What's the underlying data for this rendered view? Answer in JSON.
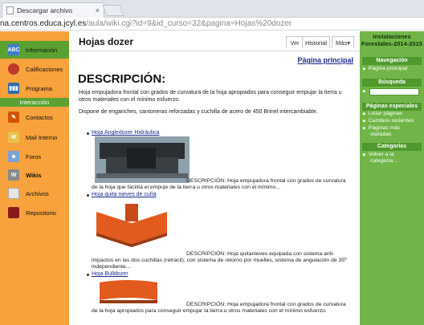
{
  "browser": {
    "tab_title": "Descargar archivo",
    "tab_close": "×",
    "url_host": "na.centros.educa.jcyl.es",
    "url_path": "/aula/wiki.cgi?id=9&id_curso=32&pagina=Hojas%20dozer"
  },
  "sidebar": {
    "items": [
      {
        "label": "Información",
        "icon": "info-icon",
        "color": "#3a7fd0"
      },
      {
        "label": "Calificaciones",
        "icon": "ribbon-icon",
        "color": "#c0392b"
      },
      {
        "label": "Programa",
        "icon": "books-icon",
        "color": "#2f6fa7"
      },
      {
        "label": "Interacción",
        "icon": "",
        "color": ""
      },
      {
        "label": "Contactos",
        "icon": "pencil-icon",
        "color": "#d35400"
      },
      {
        "label": "Mail Interno",
        "icon": "mail-icon",
        "color": "#e8c34a"
      },
      {
        "label": "Foros",
        "icon": "forum-icon",
        "color": "#7aa2d6"
      },
      {
        "label": "Wikis",
        "icon": "wiki-icon",
        "color": "#8a8a8a"
      },
      {
        "label": "Archivos",
        "icon": "folder-icon",
        "color": "#e5e5e5"
      },
      {
        "label": "Repositorio",
        "icon": "briefcase-icon",
        "color": "#8b1a1a"
      }
    ]
  },
  "page": {
    "title": "Hojas dozer",
    "tabs": [
      "Ver",
      "Historial",
      "Más▾"
    ],
    "main_link": "Página principal",
    "heading": "DESCRIPCIÓN:",
    "paragraph1": "Hoja empujadora frontal con grados de curvatura de la hoja apropiados para conseguir empujar la tierra u otros materiales con el mínimo esfuerzo.",
    "paragraph2": "Dispone de enganches, cantoneras reforzadas y cuchilla de acero de 450 Brinel intercambiable.",
    "items": [
      {
        "link": "Hoja Angledozer Hidráulica",
        "desc": "DESCRIPCIÓN:   Hoja empujadora frontal con grados de curvatura de la hoja que facilita el empuje de la tierra u otros materiales con el mínimo..."
      },
      {
        "link": "Hoja quita nieves de cuña",
        "desc": "DESCRIPCIÓN:   Hoja quitanieves equipada con sistema anti-impactos en las dos cuchillas (retracil), con sistema de retorno por muelles, sistema de angulación de 35º independiente..."
      },
      {
        "link": "Hoja Bulldozer",
        "desc": "DESCRIPCIÓN:   Hoja empujadora frontal con grados de curvatura de la hoja apropiados para conseguir empujar la tierra u otros materiales con el mínimo esfuerzo."
      }
    ]
  },
  "right": {
    "site_title_1": "Instalaciones",
    "site_title_2": "Forestales-2014-2015",
    "nav_head": "Navegación",
    "nav_links": [
      "Página principal"
    ],
    "search_head": "Búsqueda",
    "special_head": "Páginas especiales",
    "special_links": [
      "Listar páginas",
      "Cambios recientes",
      "Páginas más",
      "visitadas"
    ],
    "cat_head": "Categorías",
    "cat_links": [
      "Volver a la",
      "categoría..."
    ]
  },
  "colors": {
    "sidebar_orange": "#f7a23c",
    "sidebar_green": "#5aa131",
    "right_green": "#71b548",
    "link_blue": "#1a2a8a"
  }
}
